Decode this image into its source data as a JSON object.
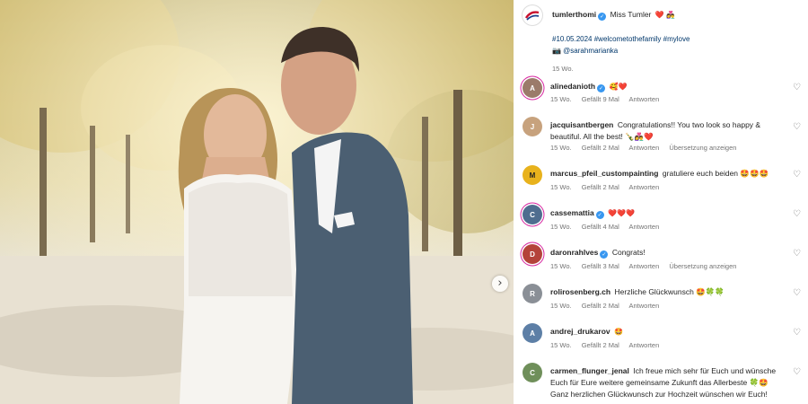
{
  "post": {
    "username": "tumlerthomi",
    "caption_text": "Miss Tumler",
    "caption_emoji": "❤️ 👩‍❤️‍👨",
    "hashtags": "#10.05.2024 #welcometothefamily #mylove",
    "photo_credit": "📷 @sarahmarianka",
    "time": "15 Wo."
  },
  "comments": [
    {
      "username": "alinedanioth",
      "verified": true,
      "text": "🥰❤️",
      "time": "15 Wo.",
      "likes": "Gefällt 9 Mal",
      "reply": "Antworten",
      "translate": "",
      "avatar_color": "#9b7b6a"
    },
    {
      "username": "jacquisantbergen",
      "verified": false,
      "text": "Congratulations!! You two look so happy & beautiful. All the best! 🍾👩‍❤️‍👨❤️",
      "time": "15 Wo.",
      "likes": "Gefällt 2 Mal",
      "reply": "Antworten",
      "translate": "Übersetzung anzeigen",
      "avatar_color": "#c7a27d"
    },
    {
      "username": "marcus_pfeil_custompainting",
      "verified": false,
      "text": "gratuliere euch beiden 🤩🤩🤩",
      "time": "15 Wo.",
      "likes": "Gefällt 2 Mal",
      "reply": "Antworten",
      "translate": "",
      "avatar_color": "#e8b21c"
    },
    {
      "username": "cassemattia",
      "verified": true,
      "text": "❤️❤️❤️",
      "time": "15 Wo.",
      "likes": "Gefällt 4 Mal",
      "reply": "Antworten",
      "translate": "",
      "avatar_color": "#4f6d8f"
    },
    {
      "username": "daronrahlves",
      "verified": true,
      "text": "Congrats!",
      "time": "15 Wo.",
      "likes": "Gefällt 3 Mal",
      "reply": "Antworten",
      "translate": "Übersetzung anzeigen",
      "avatar_color": "#b4433a"
    },
    {
      "username": "rolirosenberg.ch",
      "verified": false,
      "text": "Herzliche Glückwunsch 🤩🍀🍀",
      "time": "15 Wo.",
      "likes": "Gefällt 2 Mal",
      "reply": "Antworten",
      "translate": "",
      "avatar_color": "#8a8f96"
    },
    {
      "username": "andrej_drukarov",
      "verified": false,
      "text": "🤩",
      "time": "15 Wo.",
      "likes": "Gefällt 2 Mal",
      "reply": "Antworten",
      "translate": "",
      "avatar_color": "#5d7fa6"
    },
    {
      "username": "carmen_flunger_jenal",
      "verified": false,
      "text": "Ich freue mich sehr für Euch und wünsche Euch für Eure weitere gemeinsame Zukunft das Allerbeste 🍀🤩 Ganz herzlichen Glückwunsch zur Hochzeit wünschen wir Euch!",
      "time": "",
      "likes": "",
      "reply": "",
      "translate": "",
      "avatar_color": "#6f8f5a"
    }
  ],
  "colors": {
    "link": "#00376b",
    "verified": "#3897f0",
    "muted": "#737373"
  }
}
